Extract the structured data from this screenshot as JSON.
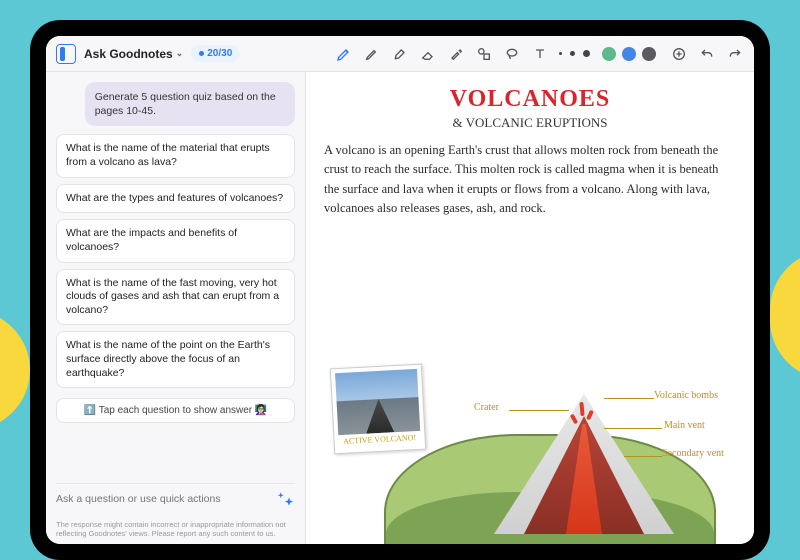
{
  "app": {
    "title": "Ask Goodnotes",
    "credits": "20/30"
  },
  "toolbar": {
    "colors": [
      "#5bb98b",
      "#4286e6",
      "#5a5a62"
    ]
  },
  "chat": {
    "prompt": "Generate 5 question quiz based on the pages 10-45.",
    "questions": [
      "What is the name of the material that erupts from a volcano as lava?",
      "What are the types and features of volcanoes?",
      "What are the impacts and benefits of volcanoes?",
      "What is the name of the fast moving, very hot clouds of gases and ash that can erupt from a volcano?",
      "What is the name of the point on the Earth's surface directly above the focus of an earthquake?"
    ],
    "tap_hint": "⬆️ Tap each question to show answer 👩🏻‍🏫",
    "input_placeholder": "Ask a question or use quick actions",
    "disclaimer": "The response might contain incorrect or inappropriate information not reflecting Goodnotes' views. Please report any such content to us."
  },
  "note": {
    "title": "VOLCANOES",
    "subtitle": "& VOLCANIC ERUPTIONS",
    "body": "A volcano is an opening Earth's crust that allows molten rock from beneath the crust to reach the surface. This molten rock is called magma when it is beneath the surface and lava when it erupts or flows from a volcano. Along with lava, volcanoes also releases gases, ash, and rock.",
    "photo_caption": "ACTIVE VOLCANO!",
    "labels": {
      "crater": "Crater",
      "bombs": "Volcanic bombs",
      "main_vent": "Main vent",
      "secondary_vent": "Secondary vent"
    }
  }
}
